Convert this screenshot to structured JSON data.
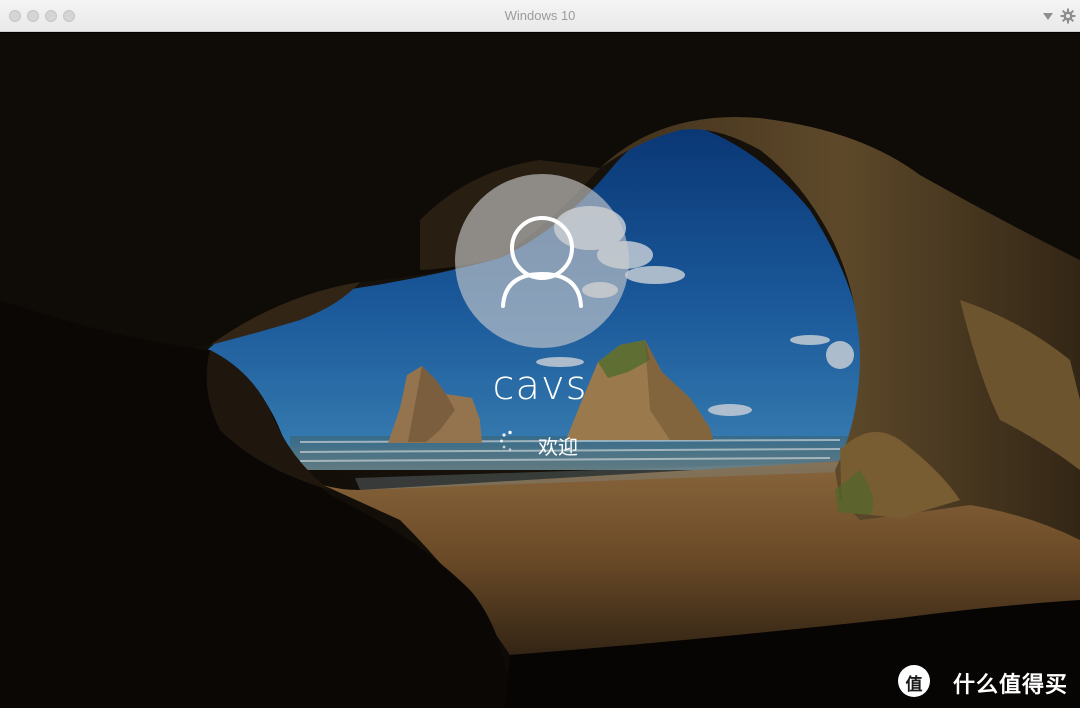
{
  "window": {
    "title": "Windows 10"
  },
  "lock_screen": {
    "username": "cavs",
    "status": "欢迎"
  },
  "watermark": {
    "logo_char": "值",
    "text": "什么值得买"
  },
  "icons": {
    "titlebar": [
      "dropdown-arrow-icon",
      "gear-icon"
    ],
    "screen": [
      "user-avatar-icon",
      "loading-spinner-icon"
    ]
  }
}
